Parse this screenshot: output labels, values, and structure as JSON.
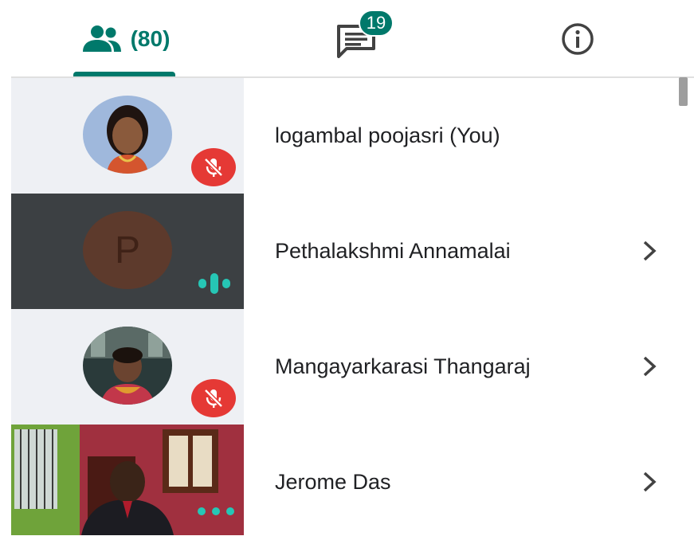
{
  "tabs": {
    "people": {
      "icon": "people-icon",
      "count_label": "(80)"
    },
    "chat": {
      "icon": "chat-icon",
      "badge": "19"
    },
    "info": {
      "icon": "info-icon"
    }
  },
  "participants": [
    {
      "name": "logambal poojasri (You)",
      "tile": "photo",
      "status": "muted",
      "chevron": false
    },
    {
      "name": "Pethalakshmi Annamalai",
      "tile": "letter",
      "letter": "P",
      "status": "speaking",
      "chevron": true
    },
    {
      "name": "Mangayarkarasi Thangaraj",
      "tile": "photo",
      "status": "muted",
      "chevron": true
    },
    {
      "name": "Jerome Das",
      "tile": "video",
      "status": "more",
      "chevron": true
    }
  ],
  "colors": {
    "accent": "#00796b",
    "mute": "#e53935",
    "speaking": "#26c6b5",
    "dark_tile": "#3c4043",
    "light_tile": "#eef0f4"
  }
}
